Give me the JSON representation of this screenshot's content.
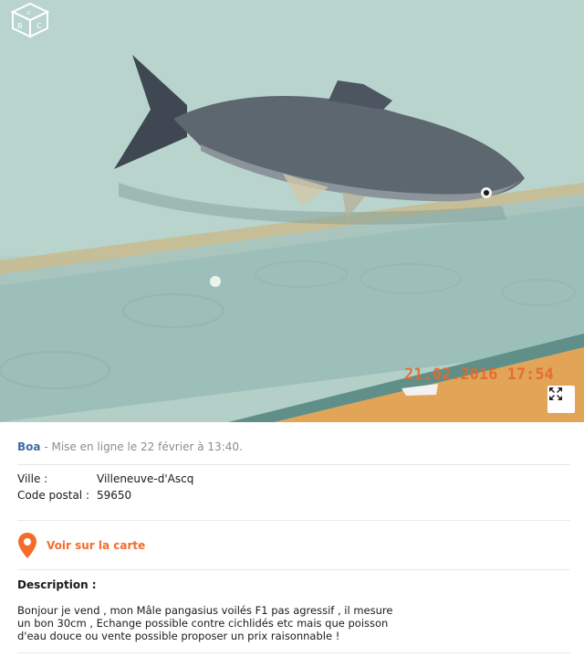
{
  "listing": {
    "author": "Boa",
    "meta": " - Mise en ligne le 22 février à 13:40.",
    "photo_timestamp": "21.02.2016 17:54"
  },
  "details": {
    "city_label": "Ville :",
    "city_value": "Villeneuve-d'Ascq",
    "postal_label": "Code postal :",
    "postal_value": "59650"
  },
  "map": {
    "label": "Voir sur la carte",
    "accent": "#f56b2a"
  },
  "description": {
    "title": "Description :",
    "lines": [
      "Bonjour je vend , mon Mâle pangasius voilés F1 pas agressif , il mesure",
      "un bon 30cm , Echange possible contre cichlidés etc mais que poisson",
      "d'eau douce ou vente possible proposer un prix raisonnable !"
    ]
  },
  "icons": {
    "logo": "leboncoin-cube-logo",
    "expand": "expand-arrows-icon",
    "pin": "map-pin-icon"
  }
}
